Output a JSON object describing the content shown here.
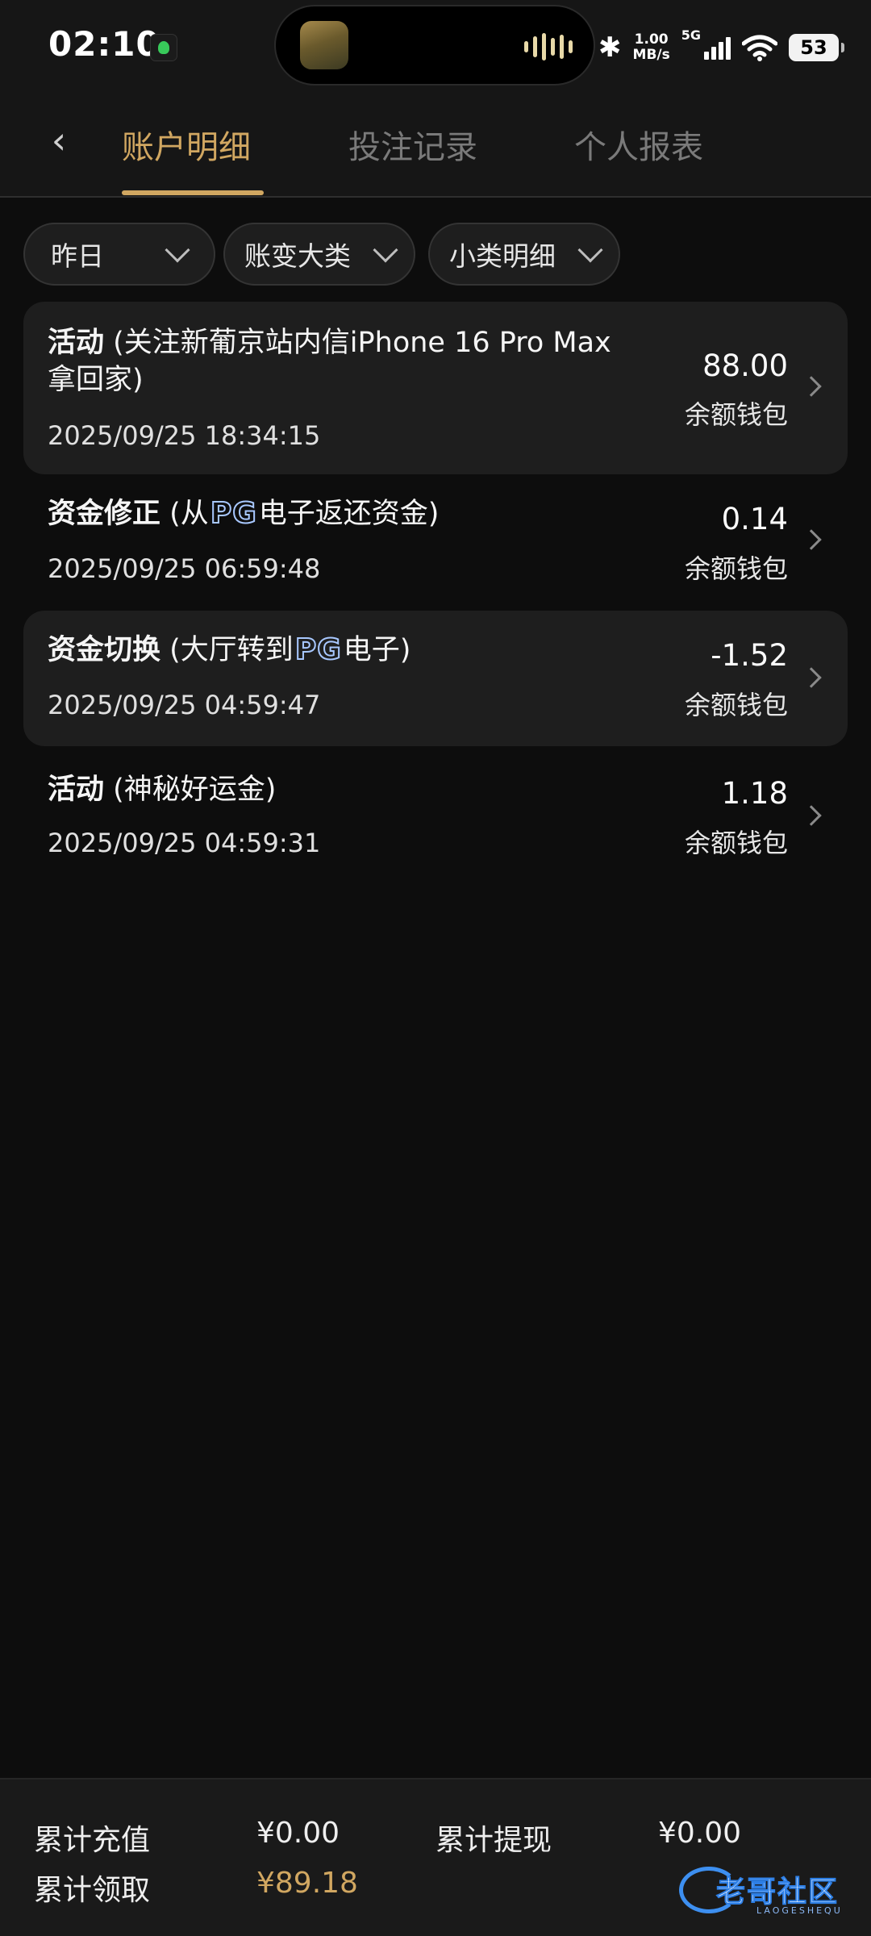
{
  "status_bar": {
    "time": "02:10",
    "net_speed_value": "1.00",
    "net_speed_unit": "MB/s",
    "network": "5G",
    "battery": "53"
  },
  "header": {
    "tabs": [
      {
        "label": "账户明细",
        "active": true
      },
      {
        "label": "投注记录",
        "active": false
      },
      {
        "label": "个人报表",
        "active": false
      }
    ]
  },
  "filters": [
    {
      "label": "昨日"
    },
    {
      "label": "账变大类"
    },
    {
      "label": "小类明细"
    }
  ],
  "transactions": [
    {
      "category": "活动",
      "detail_line1": "(关注新葡京站内信iPhone 16 Pro Max",
      "detail_line2": "拿回家)",
      "date": "2025/09/25 18:34:15",
      "amount": "88.00",
      "wallet": "余额钱包"
    },
    {
      "category": "资金修正",
      "detail_prefix": "(从",
      "brand": "PG",
      "detail_suffix": "电子返还资金)",
      "date": "2025/09/25 06:59:48",
      "amount": "0.14",
      "wallet": "余额钱包"
    },
    {
      "category": "资金切换",
      "detail_prefix": "(大厅转到",
      "brand": "PG",
      "detail_suffix": "电子)",
      "date": "2025/09/25 04:59:47",
      "amount": "-1.52",
      "wallet": "余额钱包"
    },
    {
      "category": "活动",
      "detail_line1": "(神秘好运金)",
      "date": "2025/09/25 04:59:31",
      "amount": "1.18",
      "wallet": "余额钱包"
    }
  ],
  "summary": {
    "recharge_label": "累计充值",
    "recharge_value": "¥0.00",
    "withdraw_label": "累计提现",
    "withdraw_value": "¥0.00",
    "claimed_label": "累计领取",
    "claimed_value": "¥89.18"
  },
  "watermark": {
    "text": "老哥社区",
    "sub": "LAOGESHEQU"
  },
  "colors": {
    "accent": "#d1a761",
    "background": "#0d0d0d",
    "card": "#1e1e1e"
  }
}
